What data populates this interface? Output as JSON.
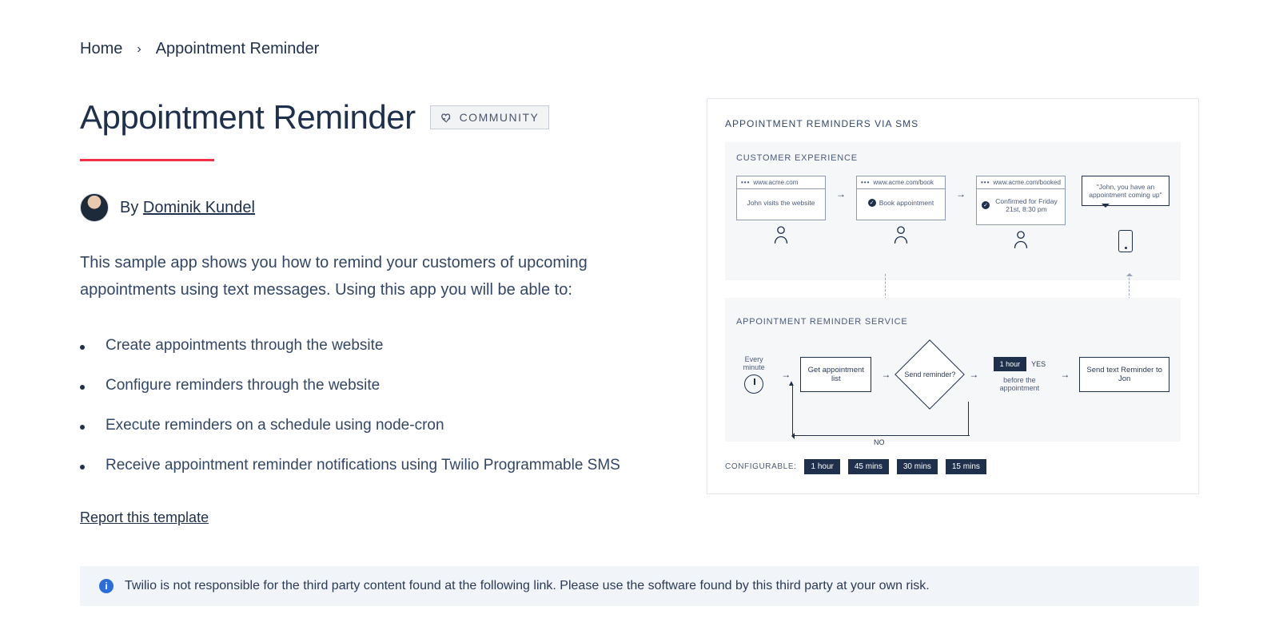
{
  "breadcrumb": {
    "home": "Home",
    "current": "Appointment Reminder"
  },
  "title": "Appointment Reminder",
  "badge": "COMMUNITY",
  "author": {
    "by": "By",
    "name": "Dominik Kundel"
  },
  "lede": "This sample app shows you how to remind your customers of upcoming appointments using text messages. Using this app you will be able to:",
  "features": [
    "Create appointments through the website",
    "Configure reminders through the website",
    "Execute reminders on a schedule using node-cron",
    "Receive appointment reminder notifications using Twilio Programmable SMS"
  ],
  "report_link": "Report this template",
  "diagram": {
    "title": "APPOINTMENT REMINDERS VIA SMS",
    "customer_experience": {
      "label": "CUSTOMER EXPERIENCE",
      "steps": [
        {
          "url": "www.acme.com",
          "text": "John visits the website",
          "check": false
        },
        {
          "url": "www.acme.com/book",
          "text": "Book appointment",
          "check": true
        },
        {
          "url": "www.acme.com/booked",
          "text": "Confirmed for Friday 21st, 8:30 pm",
          "check": true
        }
      ],
      "bubble": "\"John, you have an appointment coming up\""
    },
    "service": {
      "label": "APPOINTMENT REMINDER SERVICE",
      "every": "Every minute",
      "get_list": "Get appointment list",
      "decision": "Send reminder?",
      "before": "before the appointment",
      "yes": "YES",
      "no": "NO",
      "hour": "1 hour",
      "send": "Send text Reminder to Jon"
    },
    "configurable": {
      "label": "CONFIGURABLE:",
      "options": [
        "1 hour",
        "45 mins",
        "30 mins",
        "15 mins"
      ]
    }
  },
  "notice": "Twilio is not responsible for the third party content found at the following link. Please use the software found by this third party at your own risk."
}
